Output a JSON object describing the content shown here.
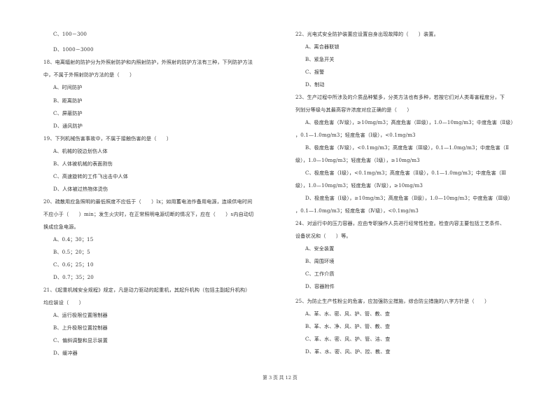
{
  "left_column": {
    "lines": [
      {
        "kind": "opt",
        "text": "C、100－300"
      },
      {
        "kind": "opt",
        "text": "D、1000－3000"
      },
      {
        "kind": "q",
        "text": "18、电离辐射的防护分为外照射防护和内照射防护，外照射的防护方法有三种，下列防护方法"
      },
      {
        "kind": "cont",
        "text": "中，不属于外照射防护方法的是（　　）"
      },
      {
        "kind": "opt",
        "text": "A、时间防护"
      },
      {
        "kind": "opt",
        "text": "B、距离防护"
      },
      {
        "kind": "opt",
        "text": "C、屏蔽防护"
      },
      {
        "kind": "opt",
        "text": "D、通风防护"
      },
      {
        "kind": "q",
        "text": "19、下列机械伤害事故中，不属于接触伤害的是（　　）"
      },
      {
        "kind": "opt",
        "text": "A、机械的锐边划伤人体"
      },
      {
        "kind": "opt",
        "text": "B、人体被机械的表面割伤"
      },
      {
        "kind": "opt",
        "text": "C、高速旋转的工件飞出击中人体"
      },
      {
        "kind": "opt",
        "text": "D、人体被过热物体烫伤"
      },
      {
        "kind": "q",
        "text": "20、疏散用应急照明的最低照度不应低于（　　）lx；如用蓄电池作备用电源，连续供电时间"
      },
      {
        "kind": "cont",
        "text": "不应小于（　　）min；发生火灾时，在正常照明电源切断的情况下，应在（　　）s内自动切"
      },
      {
        "kind": "cont",
        "text": "换成应急电源。"
      },
      {
        "kind": "opt",
        "text": "A、0.4；30；15"
      },
      {
        "kind": "opt",
        "text": "B、0.5；20；5"
      },
      {
        "kind": "opt",
        "text": "C、0.6；25；10"
      },
      {
        "kind": "opt",
        "text": "D、0.7；35；20"
      },
      {
        "kind": "q",
        "text": "21、《起重机械安全规程》规定，凡是动力驱动的起重机，其起升机构（包括主副起升机构）"
      },
      {
        "kind": "cont",
        "text": "均应装设（　　）"
      },
      {
        "kind": "opt",
        "text": "A、运行极限位置限制器"
      },
      {
        "kind": "opt",
        "text": "B、上升极限位置控制器"
      },
      {
        "kind": "opt",
        "text": "C、偏斜调整和显示装置"
      },
      {
        "kind": "opt",
        "text": "D、缓冲器"
      }
    ]
  },
  "right_column": {
    "lines": [
      {
        "kind": "q",
        "text": "22、光电式安全防护装置应设置自身出现故障的（　　）装置。"
      },
      {
        "kind": "opt",
        "text": "A、离合器联锁"
      },
      {
        "kind": "opt",
        "text": "B、紧急开关"
      },
      {
        "kind": "opt",
        "text": "C、报警"
      },
      {
        "kind": "opt",
        "text": "D、制动"
      },
      {
        "kind": "q",
        "text": "23、生产过程中所涉及的介质品种繁多，分类方法也有多种，若按它们对人类毒害程度分，下"
      },
      {
        "kind": "cont",
        "text": "列划分等级与其最高容许浓度对应正确的是（　　）"
      },
      {
        "kind": "opt",
        "text": "A、极度危害（Ⅳ级），≥10mg/m3；高度危害（Ⅲ级），1.0—10mg/m3；中度危害（Ⅱ级）"
      },
      {
        "kind": "cont",
        "text": "，0.1—1.0mg/m3；轻度危害（Ⅰ级），<0.1mg/m3"
      },
      {
        "kind": "opt",
        "text": "B、极度危害（Ⅳ级），<0.1mg/m3；高度危害（Ⅲ级），0.1—1.0mg/m3；中度危害（Ⅱ"
      },
      {
        "kind": "cont",
        "text": "级），1.0—10mg/m3；轻度危害（Ⅰ级），≥10mg/m3"
      },
      {
        "kind": "opt",
        "text": "C、极度危害（Ⅰ级），<0.1mg/m3；高度危害（Ⅱ级），0.1—1.0mg/m3；中度危害（Ⅲ"
      },
      {
        "kind": "cont",
        "text": "级），1.0—10mg/m3；轻度危害（Ⅳ级），≥10mg/m3"
      },
      {
        "kind": "opt",
        "text": "D、极度危害（Ⅰ级），≥10mg/m3；高度危害（Ⅱ级），1.0—10mg/m3；中度危害（Ⅲ级）"
      },
      {
        "kind": "cont",
        "text": "，0.1—1.0mg/m3；轻度危害（Ⅳ级），<0.1mg/m3"
      },
      {
        "kind": "q",
        "text": "24、对运行中的压力容器，应由专职操作人员进行经常性检查。检查内容主要包括工艺条件、"
      },
      {
        "kind": "cont",
        "text": "设备状况和（　　）等。"
      },
      {
        "kind": "opt",
        "text": "A、安全装置"
      },
      {
        "kind": "opt",
        "text": "B、周围环境"
      },
      {
        "kind": "opt",
        "text": "C、工作介质"
      },
      {
        "kind": "opt",
        "text": "D、容器附件"
      },
      {
        "kind": "q",
        "text": "25、为防止生产性粉尘的危害，应加强防尘措施，综合防尘措施的八字方针是（　　）"
      },
      {
        "kind": "opt",
        "text": "A、革、水、密、风、护、管、教、查"
      },
      {
        "kind": "opt",
        "text": "B、革、水、净、风、护、管、教、查"
      },
      {
        "kind": "opt",
        "text": "C、革、水、密、风、护、管、洁、查"
      },
      {
        "kind": "opt",
        "text": "D、革、水、密、风、护、控、教、查"
      }
    ]
  },
  "footer": {
    "page_label": "第 3 页 共 12 页"
  }
}
